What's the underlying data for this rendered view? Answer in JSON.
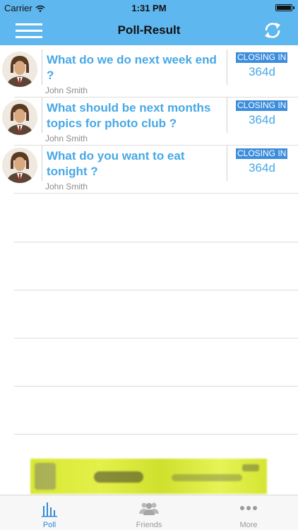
{
  "status_bar": {
    "carrier": "Carrier",
    "time": "1:31 PM"
  },
  "nav": {
    "title": "Poll-Result",
    "menu_icon": "hamburger-menu-icon",
    "refresh_icon": "refresh-icon"
  },
  "polls": [
    {
      "question": "What do we do next week end ?",
      "author": "John Smith",
      "closing_label": "CLOSING IN",
      "closing_value": "364d"
    },
    {
      "question": "What should be next months topics for photo club ?",
      "author": "John Smith",
      "closing_label": "CLOSING IN",
      "closing_value": "364d"
    },
    {
      "question": "What do you want to eat tonight ?",
      "author": "John Smith",
      "closing_label": "CLOSING IN",
      "closing_value": "364d"
    }
  ],
  "tabs": [
    {
      "label": "Poll",
      "icon": "bar-chart-icon",
      "active": true
    },
    {
      "label": "Friends",
      "icon": "friends-icon",
      "active": false
    },
    {
      "label": "More",
      "icon": "more-dots-icon",
      "active": false
    }
  ],
  "colors": {
    "nav_bar": "#5fb7ef",
    "question_text": "#46a8e6",
    "closing_badge": "#3d8ddc",
    "active_tab": "#2f88d6",
    "ad_banner": "#d7e832"
  }
}
